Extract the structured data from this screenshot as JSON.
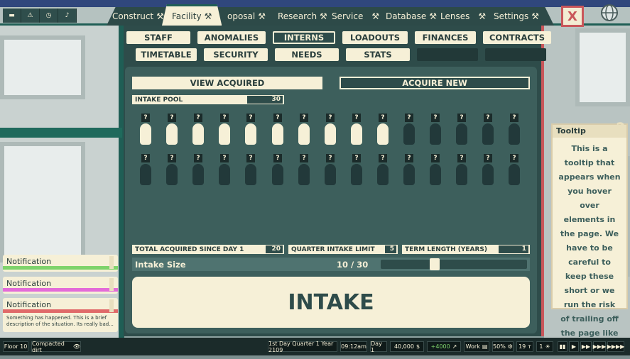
{
  "top_mini_tabs": [
    "▬",
    "⚠",
    "◷",
    "♪"
  ],
  "nav": {
    "tabs": [
      {
        "label": "Construct",
        "icon": "⚒"
      },
      {
        "label": "Facility",
        "icon": "⚒",
        "active": true
      },
      {
        "label": "oposal",
        "icon": "⚒"
      },
      {
        "label": "Research",
        "icon": "⚒"
      },
      {
        "label": "Service",
        "icon": "⚒"
      },
      {
        "label": "Database",
        "icon": "⚒"
      },
      {
        "label": "Lenses",
        "icon": "⚒"
      },
      {
        "label": "Settings",
        "icon": "⚒"
      }
    ],
    "close_label": "X",
    "globe_icon": "🌐"
  },
  "subnav_row1": [
    "STAFF",
    "ANOMALIES",
    "INTERNS",
    "LOADOUTS",
    "FINANCES",
    "CONTRACTS"
  ],
  "subnav_row2": [
    "TIMETABLE",
    "SECURITY",
    "NEEDS",
    "STATS",
    "",
    ""
  ],
  "actions": {
    "view": "VIEW ACQUIRED",
    "acquire": "ACQUIRE NEW"
  },
  "pool": {
    "label": "INTAKE POOL",
    "value": "30",
    "acquired": 10,
    "total": 30,
    "question": "?"
  },
  "stats": [
    {
      "label": "TOTAL ACQUIRED SINCE DAY 1",
      "value": "20"
    },
    {
      "label": "QUARTER INTAKE LIMIT",
      "value": "5"
    },
    {
      "label": "TERM LENGTH (YEARS)",
      "value": "1"
    }
  ],
  "intake_size": {
    "label": "Intake Size",
    "value": "10 / 30",
    "fraction": 0.33
  },
  "intake_button": "INTAKE",
  "tooltip": {
    "title": "Tooltip",
    "text": "This is a tooltip that appears when you hover over elements in the page. We have to be careful to keep these short or we run the risk of trailing off the page like this...",
    "mark": "?"
  },
  "notifications": [
    {
      "title": "Notification",
      "color": "#7ed36b"
    },
    {
      "title": "Notification",
      "color": "#e36bd8"
    },
    {
      "title": "Notification",
      "color": "#e06a6a",
      "message": "Something has happened.  This is a brief description of the situation. Its really bad..."
    }
  ],
  "status_bar": {
    "floor": "Floor 10",
    "terrain": "Compacted dirt",
    "date": "1st Day Quarter 1 Year 2109",
    "time": "09:12am",
    "day": "Day 1",
    "money": "40,000",
    "currency": "$",
    "income": "+4000",
    "mode": "Work",
    "pct": "50%",
    "count1": "19",
    "count2": "1",
    "speed_controls": [
      "▮▮",
      "▶",
      "▶▶",
      "▶▶▶",
      "▶▶▶▶"
    ]
  },
  "colors": {
    "accent": "#f6f0d7",
    "panel": "#2e4c4a",
    "alert": "#c9565a",
    "income": "#7ed36b"
  }
}
